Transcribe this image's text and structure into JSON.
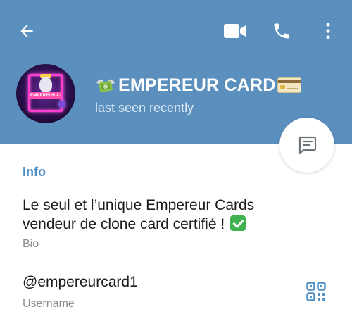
{
  "colors": {
    "header_bg": "#5a8fbe",
    "accent": "#4f8fc5",
    "caption_text": "#8c8c8c",
    "verified_green": "#3fb34f"
  },
  "header": {
    "back_icon": "arrow-left-icon",
    "actions": [
      {
        "icon": "video-camera-icon"
      },
      {
        "icon": "phone-icon"
      },
      {
        "icon": "more-vertical-icon"
      }
    ]
  },
  "profile": {
    "avatar_label": "EMPEREUR CARDS",
    "name": "EMPEREUR CARD",
    "name_prefix_icon": "money-with-wings-icon",
    "name_suffix_icon": "credit-card-icon",
    "status": "last seen recently"
  },
  "fab": {
    "icon": "message-icon"
  },
  "info": {
    "title": "Info",
    "bio_line1": "Le seul et l’unique Empereur Cards",
    "bio_line2": "vendeur de clone card certifié !",
    "bio_emoji": "check-mark-icon",
    "bio_caption": "Bio",
    "username": "@empereurcard1",
    "username_caption": "Username",
    "qr_icon": "qr-code-icon"
  }
}
